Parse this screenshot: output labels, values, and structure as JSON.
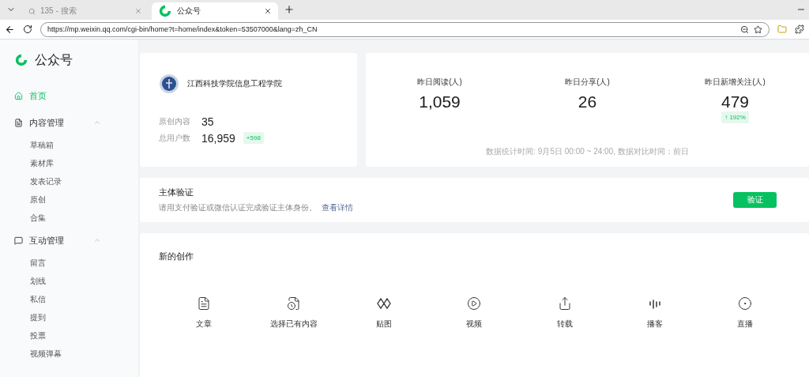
{
  "browser": {
    "tabs": [
      {
        "title": "135 - 搜索",
        "selected": false
      },
      {
        "title": "公众号",
        "selected": true
      }
    ],
    "url": "https://mp.weixin.qq.com/cgi-bin/home?t=home/index&token=53507000&lang=zh_CN"
  },
  "sidebar": {
    "brand": "公众号",
    "items": [
      {
        "label": "首页",
        "kind": "link",
        "selected": true
      },
      {
        "label": "内容管理",
        "kind": "group",
        "expanded": true,
        "children": [
          {
            "label": "草稿箱",
            "selected": false
          },
          {
            "label": "素材库",
            "selected": false
          },
          {
            "label": "发表记录",
            "selected": false
          },
          {
            "label": "原创",
            "selected": false
          },
          {
            "label": "合集",
            "selected": false
          }
        ]
      },
      {
        "label": "互动管理",
        "kind": "group",
        "expanded": true,
        "children": [
          {
            "label": "留言",
            "selected": false
          },
          {
            "label": "划线",
            "selected": false
          },
          {
            "label": "私信",
            "selected": false
          },
          {
            "label": "提到",
            "selected": false
          },
          {
            "label": "投票",
            "selected": false
          },
          {
            "label": "视频弹幕",
            "selected": false
          }
        ]
      }
    ]
  },
  "profile": {
    "name": "江西科技学院信息工程学院",
    "rows": [
      {
        "label": "原创内容",
        "value": "35"
      },
      {
        "label": "总用户数",
        "value": "16,959",
        "badge": "+598"
      }
    ]
  },
  "stats": {
    "items": [
      {
        "label": "昨日阅读(人)",
        "value": "1,059"
      },
      {
        "label": "昨日分享(人)",
        "value": "26"
      },
      {
        "label": "昨日新增关注(人)",
        "value": "479",
        "change": "↑ 192%"
      }
    ],
    "note": "数据统计时间: 9月5日 00:00 ~ 24:00, 数据对比时间：前日"
  },
  "verify": {
    "title": "主体验证",
    "description": "请用支付验证或微信认证完成验证主体身份。",
    "link": "查看详情",
    "button": "验证"
  },
  "create": {
    "title": "新的创作",
    "items": [
      {
        "label": "文章"
      },
      {
        "label": "选择已有内容"
      },
      {
        "label": "贴图"
      },
      {
        "label": "视频"
      },
      {
        "label": "转载"
      },
      {
        "label": "播客"
      },
      {
        "label": "直播"
      }
    ]
  }
}
